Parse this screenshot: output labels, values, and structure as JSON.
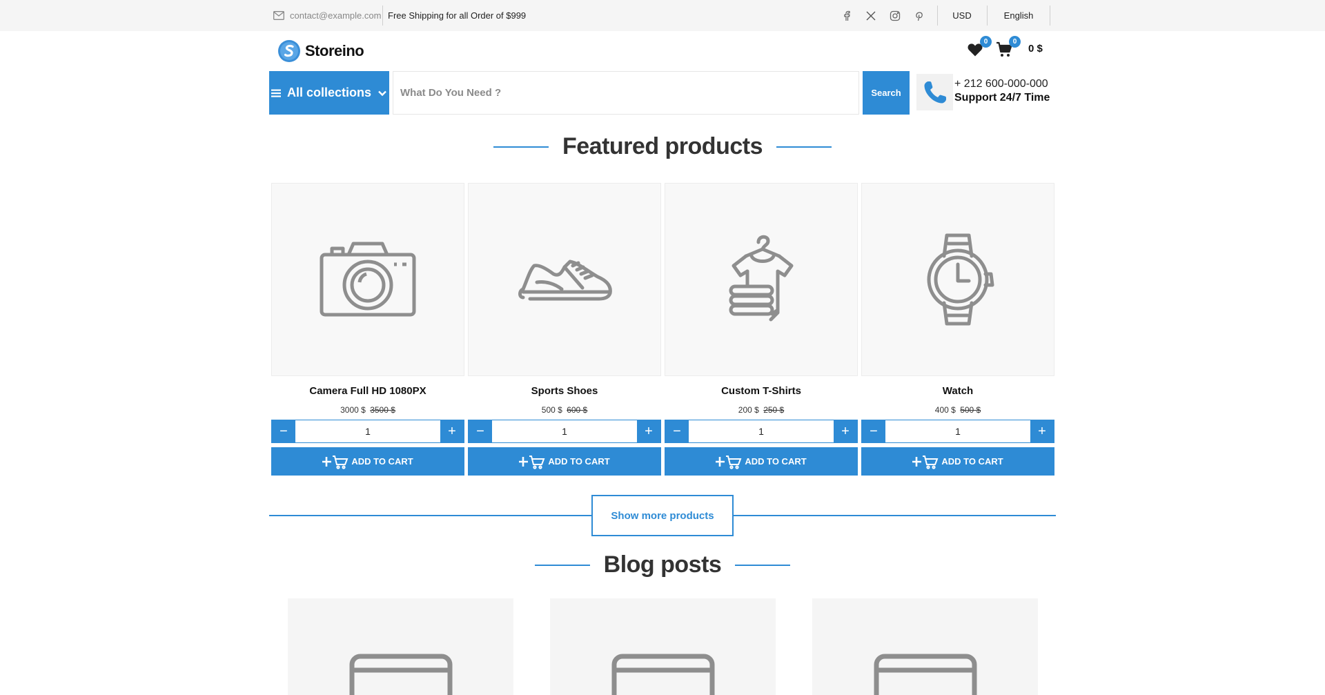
{
  "topbar": {
    "email": "contact@example.com",
    "shipping_text": "Free Shipping for all Order of $999",
    "social": [
      "facebook-icon",
      "x-icon",
      "instagram-icon",
      "pinterest-icon"
    ],
    "currency": "USD",
    "language": "English"
  },
  "header": {
    "logo_text": "Storeino",
    "wishlist_count": "0",
    "cart_count": "0",
    "cart_total": "0 $"
  },
  "search": {
    "collections_label": "All collections",
    "placeholder": "What Do You Need ?",
    "button_label": "Search",
    "phone_number": "+ 212 600-000-000",
    "support_text": "Support 24/7 Time"
  },
  "featured": {
    "title": "Featured products",
    "products": [
      {
        "name": "Camera Full HD 1080PX",
        "price": "3000",
        "old_price": "3500 $",
        "qty": "1",
        "icon": "camera-icon"
      },
      {
        "name": "Sports Shoes",
        "price": "500",
        "old_price": "600 $",
        "qty": "1",
        "icon": "shoe-icon"
      },
      {
        "name": "Custom T-Shirts",
        "price": "200",
        "old_price": "250 $",
        "qty": "1",
        "icon": "tshirt-icon"
      },
      {
        "name": "Watch",
        "price": "400",
        "old_price": "500 $",
        "qty": "1",
        "icon": "watch-icon"
      }
    ],
    "currency_symbol": "$",
    "add_to_cart_label": "ADD TO CART",
    "show_more_label": "Show more products"
  },
  "blog": {
    "title": "Blog posts"
  },
  "colors": {
    "accent": "#2e8bd5",
    "topbar_bg": "#f5f5f5",
    "placeholder_icon": "#8e8e8e"
  }
}
